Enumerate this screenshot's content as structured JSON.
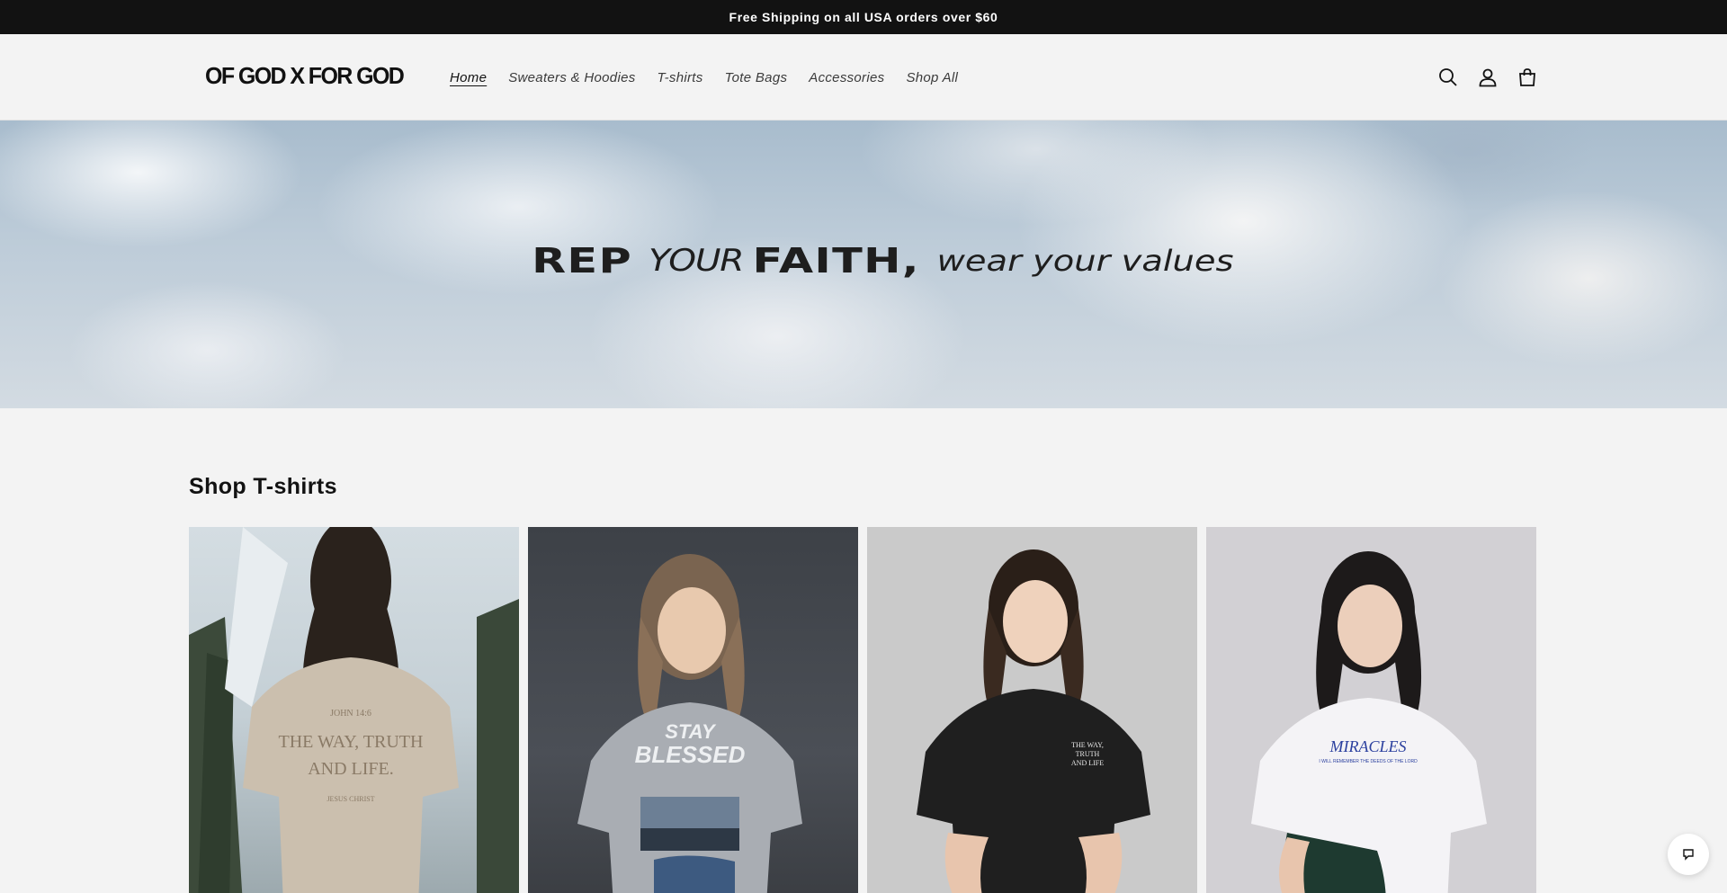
{
  "announcement": {
    "text": "Free Shipping on all USA orders over $60"
  },
  "header": {
    "logo": "OF GOD X FOR GOD",
    "nav": [
      {
        "label": "Home",
        "active": true
      },
      {
        "label": "Sweaters & Hoodies",
        "active": false
      },
      {
        "label": "T-shirts",
        "active": false
      },
      {
        "label": "Tote Bags",
        "active": false
      },
      {
        "label": "Accessories",
        "active": false
      },
      {
        "label": "Shop All",
        "active": false
      }
    ],
    "icons": [
      "search-icon",
      "account-icon",
      "cart-icon"
    ]
  },
  "hero": {
    "word1": "REP",
    "word2": "YOUR",
    "word3": "FAITH,",
    "tail": "wear your values"
  },
  "main": {
    "section_title": "Shop T-shirts",
    "products": [
      {
        "image": "woman in beige tee with back print 'The Way, Truth and Life'"
      },
      {
        "image": "woman in grey 'Stay Blessed' graphic tee"
      },
      {
        "image": "woman in black tee with small chest print"
      },
      {
        "image": "woman in white 'Miracles' graphic tee"
      }
    ]
  },
  "chat": {
    "icon": "chat-icon"
  },
  "colors": {
    "announcement_bg": "#121212",
    "page_bg": "#f3f3f3",
    "text": "#121212"
  }
}
